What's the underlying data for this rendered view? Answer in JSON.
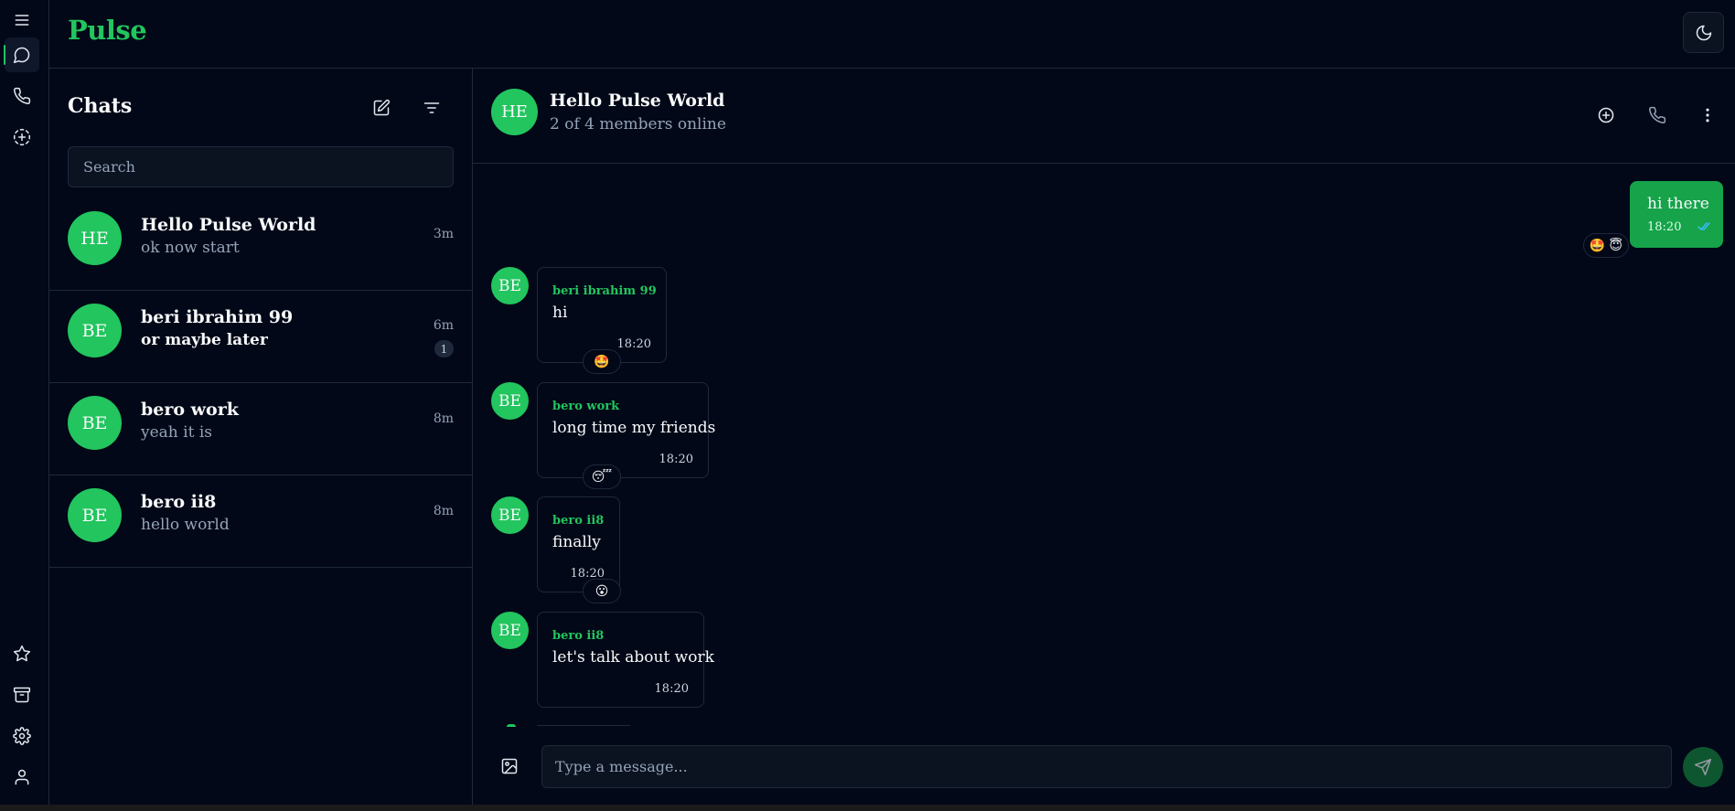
{
  "app": {
    "name": "Pulse"
  },
  "rail": {
    "icons": [
      "menu-icon",
      "chat-bubble-icon",
      "phone-icon",
      "status-icon",
      "star-icon",
      "archive-icon",
      "gear-icon",
      "user-icon"
    ],
    "active": "chat-bubble-icon"
  },
  "sidebar": {
    "title": "Chats",
    "search_placeholder": "Search",
    "chats": [
      {
        "initials": "HE",
        "name": "Hello Pulse World",
        "preview": "ok now start",
        "time": "3m",
        "unread": ""
      },
      {
        "initials": "BE",
        "name": "beri ibrahim 99",
        "preview": "or maybe later",
        "time": "6m",
        "unread": "1"
      },
      {
        "initials": "BE",
        "name": "bero work",
        "preview": "yeah it is",
        "time": "8m",
        "unread": ""
      },
      {
        "initials": "BE",
        "name": "bero ii8",
        "preview": "hello world",
        "time": "8m",
        "unread": ""
      }
    ]
  },
  "conversation": {
    "initials": "HE",
    "title": "Hello Pulse World",
    "subtitle": "2 of 4 members online",
    "own_message": {
      "text": "hi there",
      "time": "18:20",
      "reactions": "🤩 😇"
    },
    "messages": [
      {
        "initials": "BE",
        "sender": "beri ibrahim 99",
        "text": "hi",
        "time": "18:20",
        "reaction": "🤩"
      },
      {
        "initials": "BE",
        "sender": "bero work",
        "text": "long time my friends",
        "time": "18:20",
        "reaction": "😴"
      },
      {
        "initials": "BE",
        "sender": "bero ii8",
        "text": "finally",
        "time": "18:20",
        "reaction": "😮"
      },
      {
        "initials": "BE",
        "sender": "bero ii8",
        "text": "let's talk about work",
        "time": "18:20",
        "reaction": ""
      }
    ],
    "composer_placeholder": "Type a message..."
  },
  "colors": {
    "accent": "#22c55e",
    "own_bubble": "#16a34a",
    "background": "#020817",
    "border": "#1e293b"
  }
}
